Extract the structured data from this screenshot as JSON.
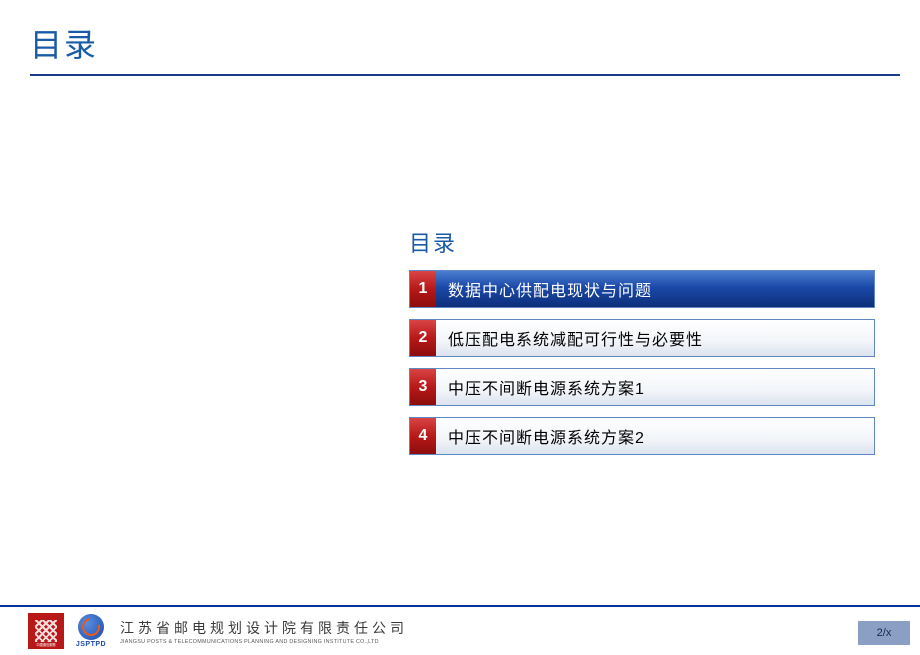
{
  "header": {
    "title": "目录"
  },
  "toc": {
    "title": "目录",
    "items": [
      {
        "num": "1",
        "label": "数据中心供配电现状与问题",
        "active": true
      },
      {
        "num": "2",
        "label": "低压配电系统减配可行性与必要性",
        "active": false
      },
      {
        "num": "3",
        "label": "中压不间断电源系统方案1",
        "active": false
      },
      {
        "num": "4",
        "label": "中压不间断电源系统方案2",
        "active": false
      }
    ]
  },
  "footer": {
    "logo_cc_caption": "中國通信服務",
    "logo_cc_sub": "CHINA COMSERVICE",
    "logo_js_text": "JSPTPD",
    "company_cn": "江苏省邮电规划设计院有限责任公司",
    "company_en": "JIANGSU POSTS & TELECOMMUNICATIONS PLANNING AND DESIGNING INSTITUTE CO.,LTD",
    "page": "2/x"
  }
}
